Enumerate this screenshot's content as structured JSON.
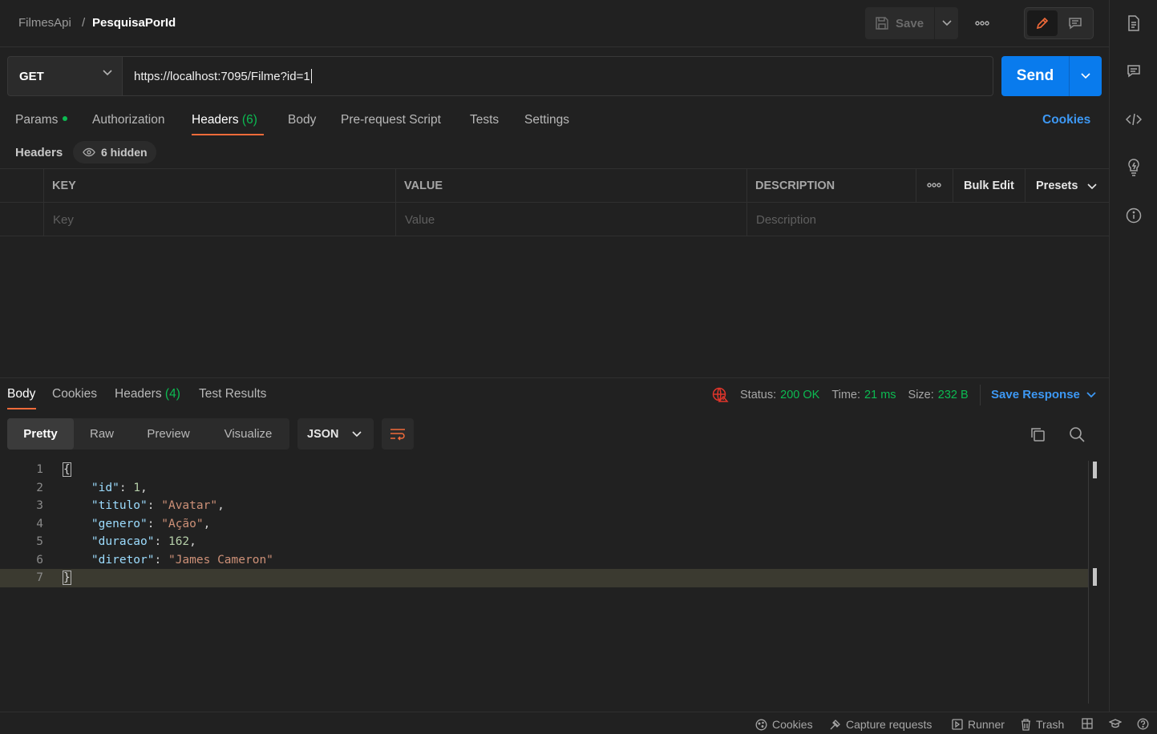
{
  "breadcrumb": {
    "collection": "FilmesApi",
    "separator": "/",
    "request": "PesquisaPorId"
  },
  "header": {
    "save_label": "Save",
    "more_label": "•••"
  },
  "request": {
    "method": "GET",
    "url": "https://localhost:7095/Filme?id=1",
    "send_label": "Send"
  },
  "request_tabs": {
    "params": "Params",
    "authorization": "Authorization",
    "headers": "Headers",
    "headers_count": "(6)",
    "body": "Body",
    "prerequest": "Pre-request Script",
    "tests": "Tests",
    "settings": "Settings",
    "cookies": "Cookies"
  },
  "headers_section": {
    "title": "Headers",
    "hidden_label": "6 hidden",
    "columns": {
      "key": "KEY",
      "value": "VALUE",
      "description": "DESCRIPTION"
    },
    "more_label": "•••",
    "bulk_edit": "Bulk Edit",
    "presets": "Presets",
    "placeholders": {
      "key": "Key",
      "value": "Value",
      "description": "Description"
    }
  },
  "response_tabs": {
    "body": "Body",
    "cookies": "Cookies",
    "headers": "Headers",
    "headers_count": "(4)",
    "test_results": "Test Results"
  },
  "response_status": {
    "status_label": "Status:",
    "status_value": "200 OK",
    "time_label": "Time:",
    "time_value": "21 ms",
    "size_label": "Size:",
    "size_value": "232 B",
    "save_response": "Save Response"
  },
  "view_modes": {
    "pretty": "Pretty",
    "raw": "Raw",
    "preview": "Preview",
    "visualize": "Visualize",
    "format": "JSON"
  },
  "code": {
    "line_numbers": [
      "1",
      "2",
      "3",
      "4",
      "5",
      "6",
      "7"
    ],
    "open_brace": "{",
    "close_brace": "}",
    "fields": [
      {
        "key": "\"id\"",
        "value": "1",
        "sep": ","
      },
      {
        "key": "\"titulo\"",
        "value": "\"Avatar\"",
        "sep": ","
      },
      {
        "key": "\"genero\"",
        "value": "\"Ação\"",
        "sep": ","
      },
      {
        "key": "\"duracao\"",
        "value": "162",
        "sep": ","
      },
      {
        "key": "\"diretor\"",
        "value": "\"James Cameron\"",
        "sep": ""
      }
    ]
  },
  "footer": {
    "cookies": "Cookies",
    "capture": "Capture requests",
    "runner": "Runner",
    "trash": "Trash"
  },
  "colors": {
    "accent_orange": "#f26b3a",
    "send_blue": "#097bed",
    "link_blue": "#3d98f4",
    "success_green": "#0cbb52",
    "background": "#212121"
  },
  "icons": [
    "save-icon",
    "chevron-down-icon",
    "more-icon",
    "pencil-icon",
    "comment-icon",
    "document-icon",
    "code-icon",
    "lightbulb-icon",
    "info-icon",
    "eye-icon",
    "globe-error-icon",
    "wrap-lines-icon",
    "copy-icon",
    "search-icon",
    "cookie-icon",
    "capture-icon",
    "runner-icon",
    "trash-icon",
    "layout-icon",
    "bootcamp-icon",
    "help-icon"
  ]
}
